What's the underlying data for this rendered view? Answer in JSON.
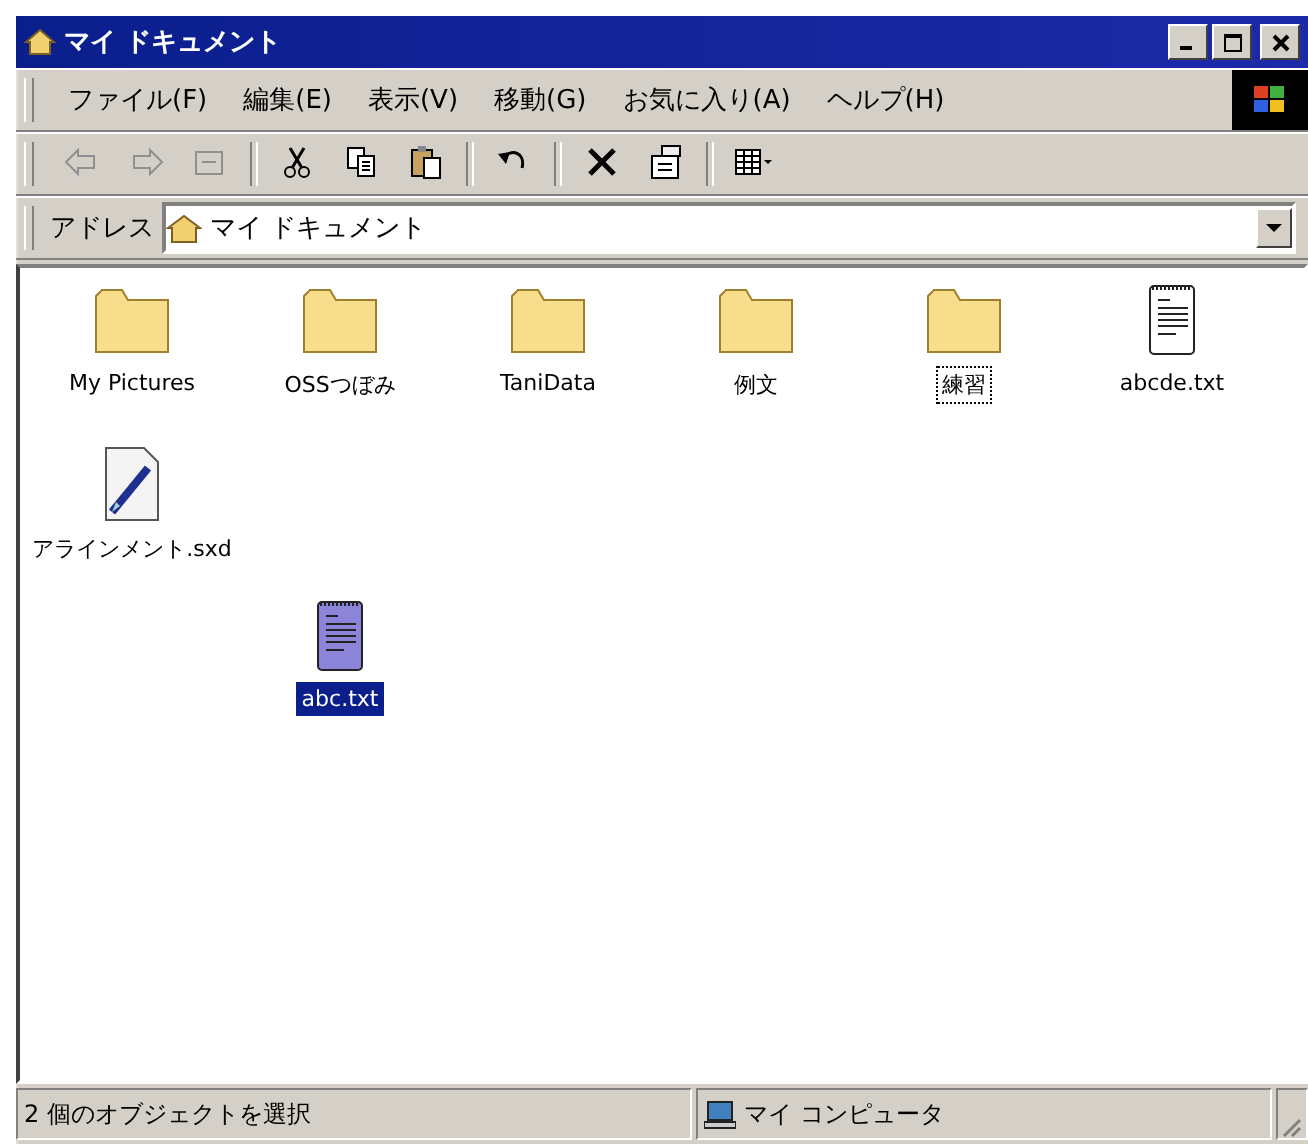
{
  "window": {
    "title": "マイ ドキュメント"
  },
  "menu": [
    "ファイル(F)",
    "編集(E)",
    "表示(V)",
    "移動(G)",
    "お気に入り(A)",
    "ヘルプ(H)"
  ],
  "toolbar": [
    {
      "kind": "back",
      "disabled": true
    },
    {
      "kind": "forward",
      "disabled": true
    },
    {
      "kind": "up",
      "disabled": true
    },
    {
      "kind": "cut",
      "disabled": false
    },
    {
      "kind": "copy",
      "disabled": false
    },
    {
      "kind": "paste",
      "disabled": false
    },
    {
      "kind": "undo",
      "disabled": false
    },
    {
      "kind": "delete",
      "disabled": false
    },
    {
      "kind": "properties",
      "disabled": false
    },
    {
      "kind": "views",
      "disabled": false
    }
  ],
  "address": {
    "label": "アドレス",
    "value": "マイ ドキュメント"
  },
  "files": [
    {
      "name": "My Pictures",
      "kind": "folder",
      "selected": false,
      "focused": false
    },
    {
      "name": "OSSつぼみ",
      "kind": "folder",
      "selected": false,
      "focused": false
    },
    {
      "name": "TaniData",
      "kind": "folder",
      "selected": false,
      "focused": false
    },
    {
      "name": "例文",
      "kind": "folder",
      "selected": false,
      "focused": false
    },
    {
      "name": "練習",
      "kind": "folder",
      "selected": false,
      "focused": true
    },
    {
      "name": "abcde.txt",
      "kind": "text",
      "selected": false,
      "focused": false
    },
    {
      "name": "アラインメント.sxd",
      "kind": "drawing",
      "selected": false,
      "focused": false
    },
    {
      "name": "abc.txt",
      "kind": "text",
      "selected": true,
      "focused": false
    }
  ],
  "status_bar": {
    "message": "2 個のオブジェクトを選択",
    "zone": "マイ コンピュータ"
  }
}
